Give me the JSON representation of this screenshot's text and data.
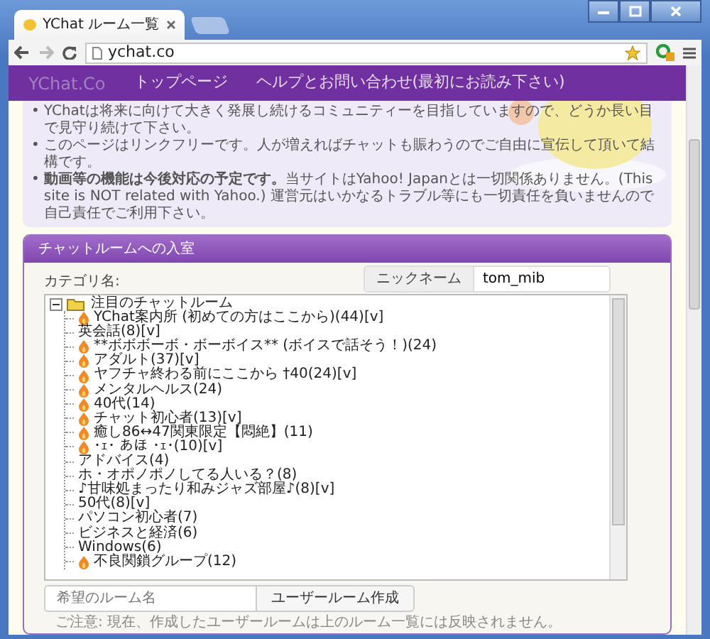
{
  "browser": {
    "tabs": [
      {
        "title": "YChat ルーム一覧",
        "selected": true
      }
    ],
    "address": "ychat.co"
  },
  "navbar": {
    "brand": "YChat.Co",
    "links": [
      "トップページ",
      "ヘルプとお問い合わせ(最初にお読み下さい)"
    ]
  },
  "notices": [
    {
      "bullet": "•",
      "text": "YChatは将来に向けて大きく発展し続けるコミュニティーを目指していますので、どうか長い目で見守り続けて下さい。"
    },
    {
      "bullet": "•",
      "text": "このページはリンクフリーです。人が増えればチャットも賑わうのでご自由に宣伝して頂いて結構です。"
    },
    {
      "bullet": "•",
      "text": "**動画等の機能は今後対応の予定です。**当サイトはYahoo! Japanとは一切関係ありません。(This site is NOT related with Yahoo.) 運営元はいかなるトラブル等にも一切責任を負いませんので自己責任でご利用下さい。"
    }
  ],
  "entry_panel": {
    "title": "チャットルームへの入室",
    "nickname_label": "ニックネーム",
    "nickname": "tom_mib",
    "category_label": "カテゴリ名:",
    "tree": [
      {
        "label": "注目のチャットルーム",
        "expanded": true,
        "children": [
          {
            "label": "YChat案内所 (初めての方はここから)(44)[v]",
            "kind": "room"
          },
          {
            "label": "英会話(8)[v]",
            "kind": "category"
          },
          {
            "label": "**ボボボーボ・ボーボイス** (ボイスで話そう！)(24)",
            "kind": "room"
          },
          {
            "label": "アダルト(37)[v]",
            "kind": "room"
          },
          {
            "label": "ヤフチャ終わる前にここから †40(24)[v]",
            "kind": "room"
          },
          {
            "label": "メンタルヘルス(24)",
            "kind": "room"
          },
          {
            "label": "40代(14)",
            "kind": "room"
          },
          {
            "label": "チャット初心者(13)[v]",
            "kind": "room"
          },
          {
            "label": "癒し86↔47関東限定【悶絶】(11)",
            "kind": "room"
          },
          {
            "label": "･ｪ･ あほ ･ｪ･(10)[v]",
            "kind": "room"
          },
          {
            "label": "アドバイス(4)",
            "kind": "category"
          },
          {
            "label": "ホ・オポノポノしてる人いる？(8)",
            "kind": "category"
          },
          {
            "label": "♪甘味処まったり和みジャズ部屋♪(8)[v]",
            "kind": "category"
          },
          {
            "label": "50代(8)[v]",
            "kind": "category"
          },
          {
            "label": "パソコン初心者(7)",
            "kind": "category"
          },
          {
            "label": "ビジネスと経済(6)",
            "kind": "category"
          },
          {
            "label": "Windows(6)",
            "kind": "category"
          },
          {
            "label": "不良関鎖グループ(12)",
            "kind": "room"
          }
        ]
      }
    ],
    "room_name_placeholder": "希望のルーム名",
    "create_button": "ユーザールーム作成",
    "note": "ご注意: 現在、作成したユーザールームは上のルーム一覧には反映されません。"
  }
}
